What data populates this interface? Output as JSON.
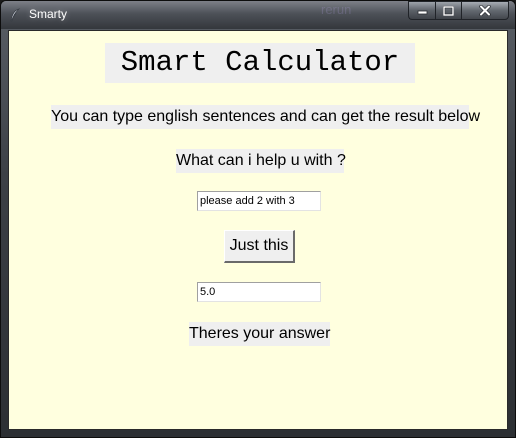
{
  "window": {
    "title": "Smarty",
    "background_title_ghost": "rerun",
    "colors": {
      "client_background": "#ffffdf",
      "label_background": "#efefef",
      "text": "#000000"
    }
  },
  "titlebar_icons": [
    "feather-icon",
    "minimize-icon",
    "maximize-icon",
    "close-icon"
  ],
  "main": {
    "heading": "Smart Calculator",
    "description": "You can type english sentences and can get the result below",
    "prompt": "What can i help u with ?",
    "query": {
      "value": "please add 2 with 3",
      "placeholder": ""
    },
    "action_button_label": "Just this",
    "result": {
      "value": "5.0"
    },
    "answer_label": "Theres your answer"
  }
}
